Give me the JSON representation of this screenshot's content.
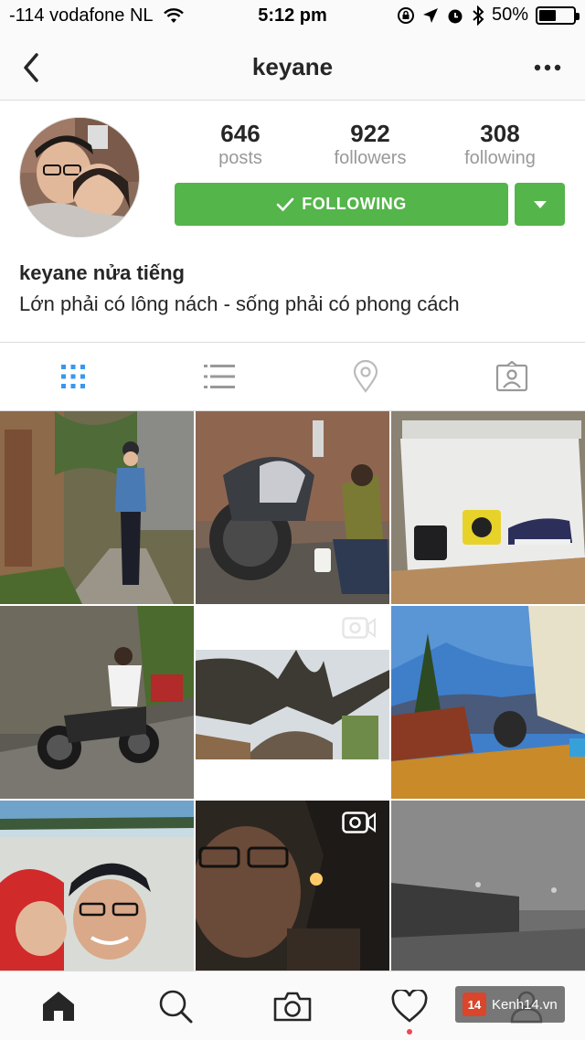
{
  "status_bar": {
    "carrier": "-114 vodafone NL",
    "time": "5:12 pm",
    "battery_percent": "50%",
    "battery_level": 0.5,
    "icons": [
      "wifi-icon",
      "rotation-lock-icon",
      "location-arrow-icon",
      "alarm-icon",
      "bluetooth-icon",
      "battery-icon"
    ]
  },
  "nav": {
    "title": "keyane",
    "back_icon": "back-chevron-icon",
    "more_icon": "more-dots-icon"
  },
  "profile": {
    "stats": [
      {
        "value": "646",
        "label": "posts"
      },
      {
        "value": "922",
        "label": "followers"
      },
      {
        "value": "308",
        "label": "following"
      }
    ],
    "follow_button_label": "FOLLOWING",
    "full_name": "keyane nửa tiếng",
    "bio": "Lớn phải có lông nách - sống phải có phong cách"
  },
  "view_tabs": [
    {
      "name": "grid-view",
      "icon": "grid-icon",
      "active": true
    },
    {
      "name": "list-view",
      "icon": "list-icon",
      "active": false
    },
    {
      "name": "map-view",
      "icon": "location-pin-icon",
      "active": false
    },
    {
      "name": "tagged-view",
      "icon": "tagged-photo-icon",
      "active": false
    }
  ],
  "posts": [
    {
      "desc": "photo",
      "video": false
    },
    {
      "desc": "photo",
      "video": false
    },
    {
      "desc": "photo",
      "video": false
    },
    {
      "desc": "photo",
      "video": false
    },
    {
      "desc": "video",
      "video": true
    },
    {
      "desc": "photo",
      "video": false
    },
    {
      "desc": "photo",
      "video": false
    },
    {
      "desc": "video",
      "video": true
    },
    {
      "desc": "photo",
      "video": false
    }
  ],
  "bottom_tabs": [
    "home-icon",
    "search-icon",
    "camera-icon",
    "heart-icon",
    "profile-icon"
  ],
  "watermark": {
    "logo": "14",
    "text": "Kenh14.vn"
  },
  "colors": {
    "follow_green": "#54b54a",
    "active_tab_blue": "#3897f0",
    "inactive_icon": "#999999",
    "notification_red": "#ed4956"
  }
}
